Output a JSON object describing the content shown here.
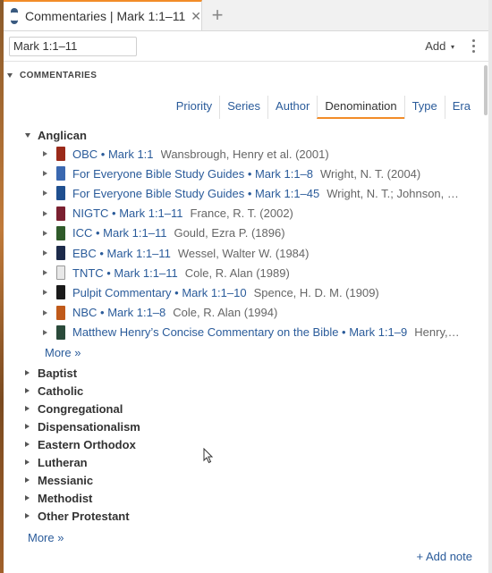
{
  "tab": {
    "title": "Commentaries | Mark 1:1–11",
    "close": "✕",
    "add": "+"
  },
  "toolbar": {
    "reference": "Mark 1:1–11",
    "add_label": "Add",
    "add_caret": "▾"
  },
  "section": {
    "title": "COMMENTARIES"
  },
  "sort_tabs": [
    {
      "label": "Priority",
      "active": false
    },
    {
      "label": "Series",
      "active": false
    },
    {
      "label": "Author",
      "active": false
    },
    {
      "label": "Denomination",
      "active": true
    },
    {
      "label": "Type",
      "active": false
    },
    {
      "label": "Era",
      "active": false
    }
  ],
  "expanded_group": {
    "label": "Anglican"
  },
  "entries": [
    {
      "title": "OBC • Mark 1:1",
      "author": "Wansbrough, Henry et al. (2001)",
      "cover_color": "#9a2a1a"
    },
    {
      "title": "For Everyone Bible Study Guides • Mark 1:1–8",
      "author": "Wright, N. T. (2004)",
      "cover_color": "#3a68b0"
    },
    {
      "title": "For Everyone Bible Study Guides • Mark 1:1–45",
      "author": "Wright, N. T.; Johnson, Lin…",
      "cover_color": "#1f4f8f"
    },
    {
      "title": "NIGTC • Mark 1:1–11",
      "author": "France, R. T. (2002)",
      "cover_color": "#7a2030"
    },
    {
      "title": "ICC • Mark 1:1–11",
      "author": "Gould, Ezra P. (1896)",
      "cover_color": "#2f5a2a"
    },
    {
      "title": "EBC • Mark 1:1–11",
      "author": "Wessel, Walter W. (1984)",
      "cover_color": "#1c2a4a"
    },
    {
      "title": "TNTC • Mark 1:1–11",
      "author": "Cole, R. Alan (1989)",
      "cover_color": "#e8e8e8"
    },
    {
      "title": "Pulpit Commentary • Mark 1:1–10",
      "author": "Spence, H. D. M. (1909)",
      "cover_color": "#1a1a1a"
    },
    {
      "title": "NBC • Mark 1:1–8",
      "author": "Cole, R. Alan (1994)",
      "cover_color": "#c05a1a"
    },
    {
      "title": "Matthew Henry’s Concise Commentary on the Bible • Mark 1:1–9",
      "author": "Henry,…",
      "cover_color": "#2a4a3a"
    }
  ],
  "entries_more": "More »",
  "collapsed_groups": [
    "Baptist",
    "Catholic",
    "Congregational",
    "Dispensationalism",
    "Eastern Orthodox",
    "Lutheran",
    "Messianic",
    "Methodist",
    "Other Protestant"
  ],
  "groups_more": "More »",
  "add_note": "+ Add note",
  "colors": {
    "accent": "#f28c28",
    "link": "#2a5b9a",
    "tab_icon": "#3a5a80"
  }
}
